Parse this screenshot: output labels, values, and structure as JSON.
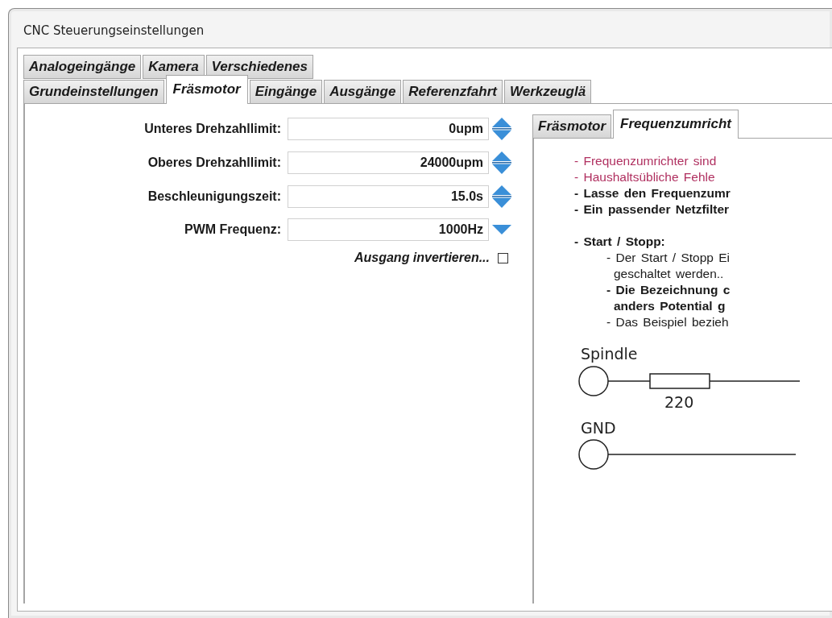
{
  "window": {
    "title": "CNC Steuerungseinstellungen"
  },
  "tab_rows": [
    [
      {
        "label": "Analogeingänge",
        "selected": false
      },
      {
        "label": "Kamera",
        "selected": false
      },
      {
        "label": "Verschiedenes",
        "selected": false
      }
    ],
    [
      {
        "label": "Grundeinstellungen",
        "selected": false
      },
      {
        "label": "Fräsmotor",
        "selected": true
      },
      {
        "label": "Eingänge",
        "selected": false
      },
      {
        "label": "Ausgänge",
        "selected": false
      },
      {
        "label": "Referenzfahrt",
        "selected": false
      },
      {
        "label": "Werkzeuglä",
        "selected": false
      }
    ]
  ],
  "settings": [
    {
      "label": "Unteres Drehzahllimit:",
      "value": "0upm",
      "kind": "updown"
    },
    {
      "label": "Oberes Drehzahllimit:",
      "value": "24000upm",
      "kind": "updown"
    },
    {
      "label": "Beschleunigungszeit:",
      "value": "15.0s",
      "kind": "updown"
    },
    {
      "label": "PWM Frequenz:",
      "value": "1000Hz",
      "kind": "down"
    }
  ],
  "invert_output": {
    "label": "Ausgang invertieren...",
    "checked": false
  },
  "sub_tabs": [
    {
      "label": "Fräsmotor",
      "selected": false
    },
    {
      "label": "Frequenzumricht",
      "selected": true
    }
  ],
  "notes": [
    {
      "lines": [
        "- Frequenzumrichter sind"
      ],
      "color": "#b03060",
      "bold": false
    },
    {
      "lines": [
        "- Haushaltsübliche Fehle"
      ],
      "color": "#b03060",
      "bold": false
    },
    {
      "lines": [
        "- Lasse den Frequenzumr"
      ],
      "color": "#1a1a1a",
      "bold": true
    },
    {
      "lines": [
        "- Ein passender Netzfilter"
      ],
      "color": "#1a1a1a",
      "bold": true
    },
    {
      "lines": [
        "- Start / Stopp:"
      ],
      "color": "#1a1a1a",
      "bold": true,
      "children": [
        {
          "lines": [
            "- Der Start / Stopp Ei",
            "geschaltet werden.."
          ],
          "color": "#1a1a1a",
          "bold": false
        },
        {
          "lines": [
            "- Die Bezeichnung c",
            "anders Potential g"
          ],
          "color": "#1a1a1a",
          "bold": true
        },
        {
          "lines": [
            "- Das Beispiel bezieh"
          ],
          "color": "#1a1a1a",
          "bold": false
        }
      ]
    }
  ],
  "schematic": {
    "top_label": "Spindle",
    "resistor_value": "220",
    "bottom_label": "GND"
  }
}
